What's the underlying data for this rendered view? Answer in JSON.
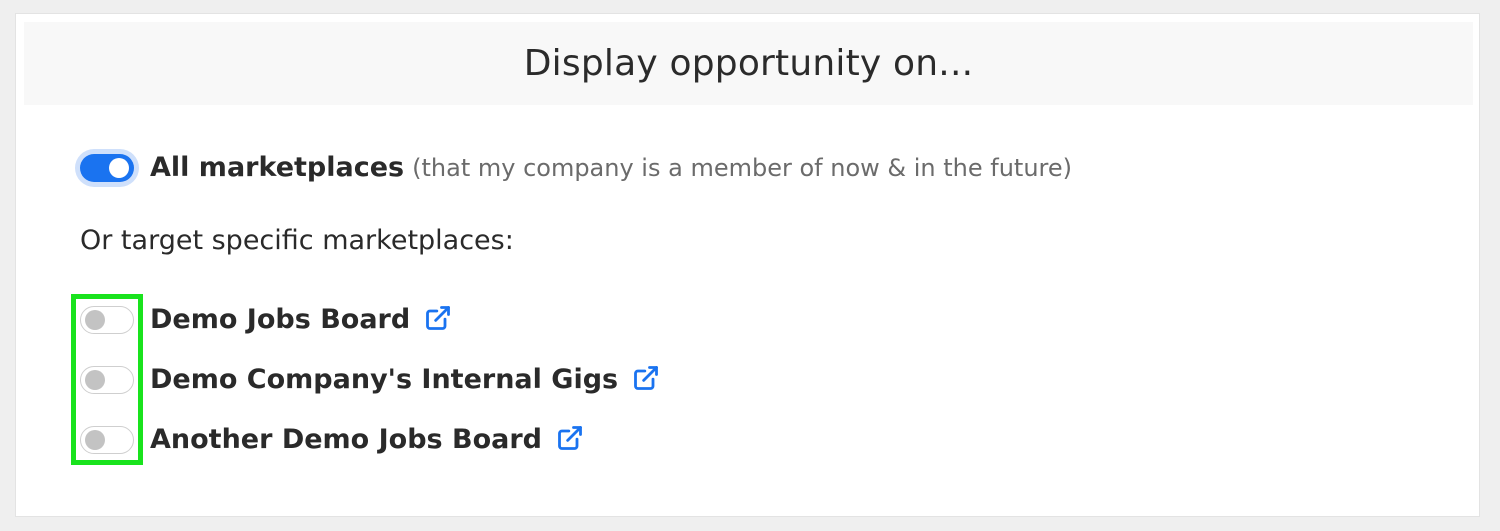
{
  "header": {
    "title": "Display opportunity on..."
  },
  "all_marketplaces": {
    "label": "All marketplaces",
    "note": "(that my company is a member of now & in the future)",
    "enabled": true
  },
  "specific": {
    "heading": "Or target specific marketplaces:",
    "items": [
      {
        "label": "Demo Jobs Board",
        "enabled": false,
        "icon": "external-link-icon"
      },
      {
        "label": "Demo Company's Internal Gigs",
        "enabled": false,
        "icon": "external-link-icon"
      },
      {
        "label": "Another Demo Jobs Board",
        "enabled": false,
        "icon": "external-link-icon"
      }
    ]
  },
  "colors": {
    "accent": "#1a73f0",
    "highlight": "#19e31d",
    "link": "#1a73f0"
  }
}
